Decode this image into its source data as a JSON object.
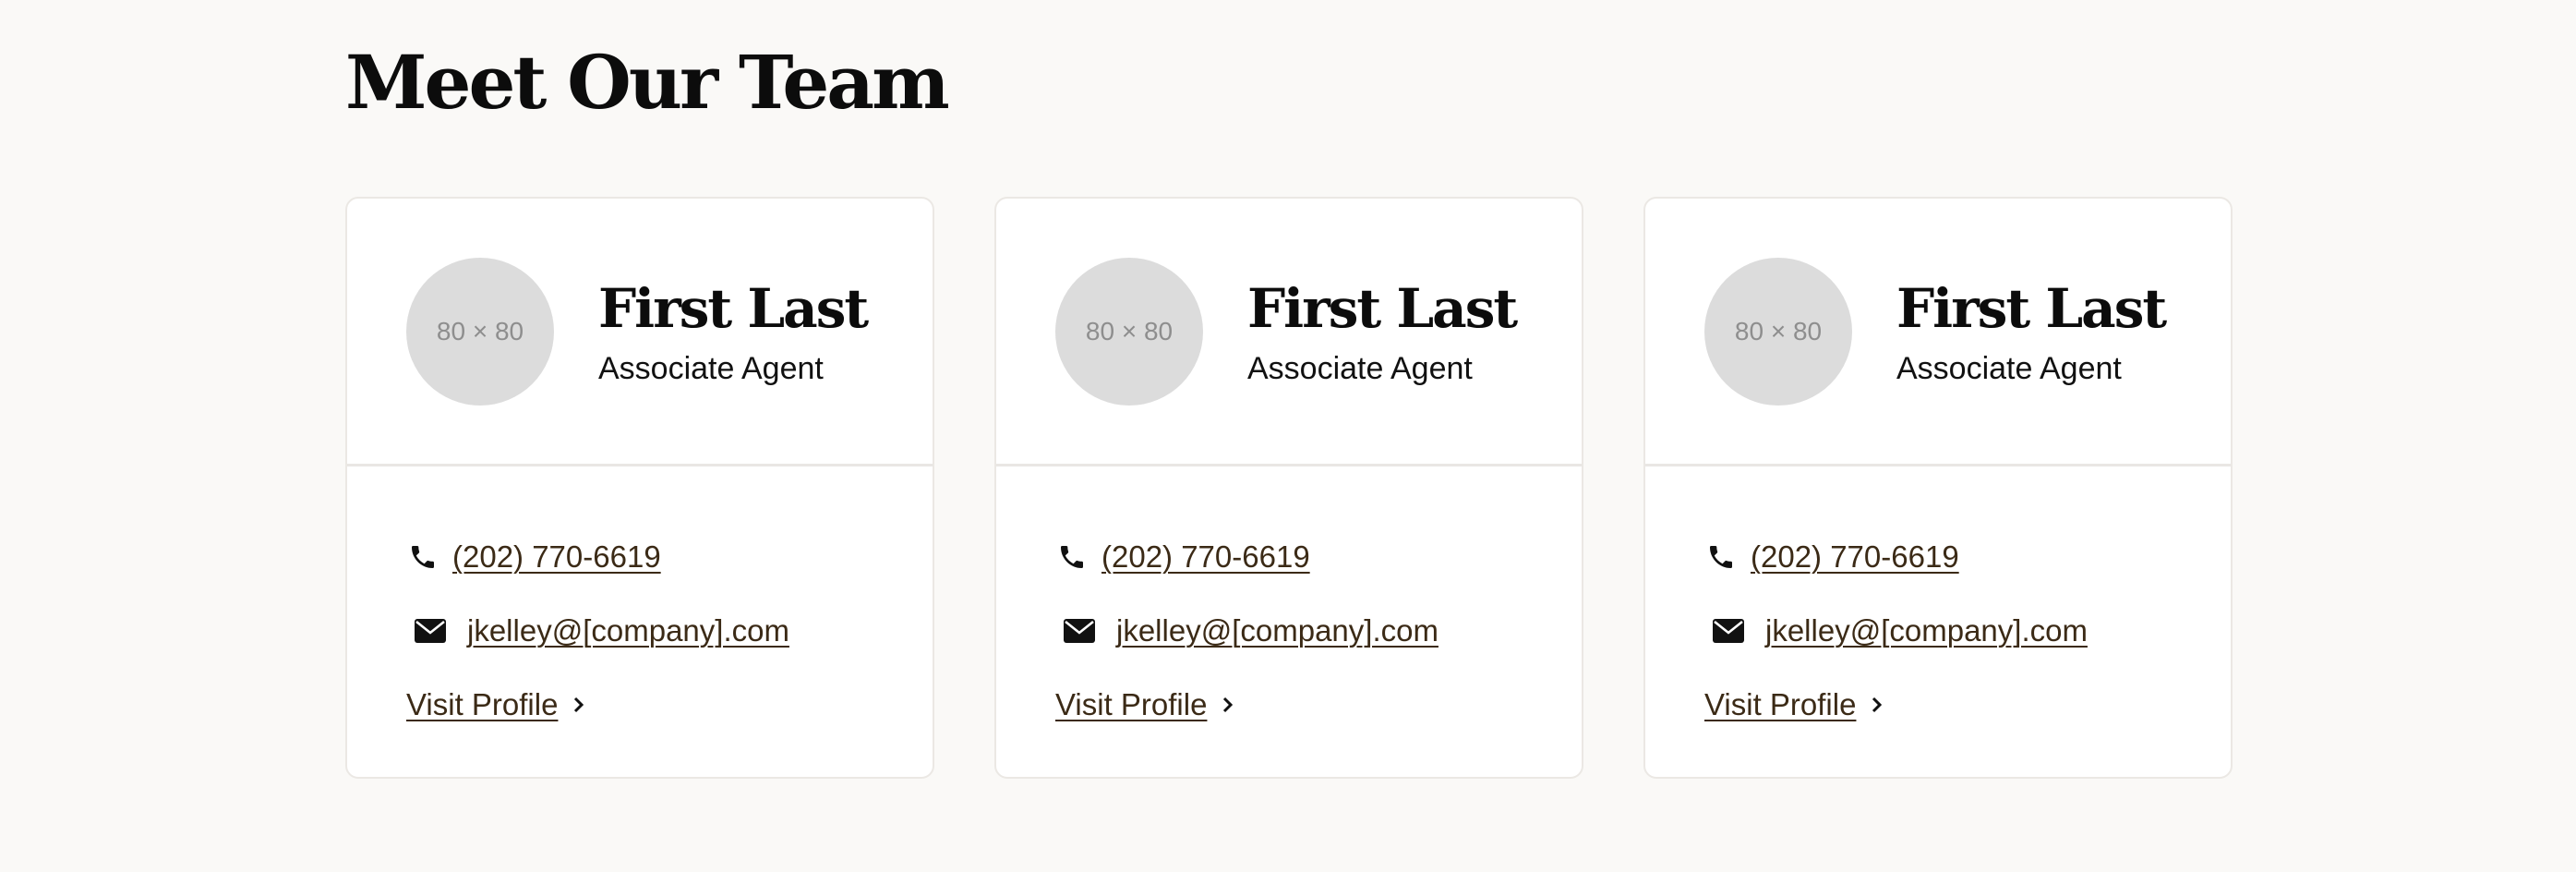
{
  "section": {
    "title": "Meet Our Team"
  },
  "colors": {
    "page_background": "#faf9f7",
    "card_background": "#ffffff",
    "avatar_placeholder": "#dcdcdc",
    "link_text": "#3b2a16"
  },
  "icons": {
    "phone": "phone-icon",
    "email": "envelope-icon",
    "profile": "chevron-right-icon"
  },
  "team": [
    {
      "avatar_text": "80 × 80",
      "name": "First Last",
      "role": "Associate Agent",
      "phone": "(202) 770-6619",
      "email": "jkelley@[company].com",
      "profile_label": "Visit Profile"
    },
    {
      "avatar_text": "80 × 80",
      "name": "First Last",
      "role": "Associate Agent",
      "phone": "(202) 770-6619",
      "email": "jkelley@[company].com",
      "profile_label": "Visit Profile"
    },
    {
      "avatar_text": "80 × 80",
      "name": "First Last",
      "role": "Associate Agent",
      "phone": "(202) 770-6619",
      "email": "jkelley@[company].com",
      "profile_label": "Visit Profile"
    }
  ]
}
